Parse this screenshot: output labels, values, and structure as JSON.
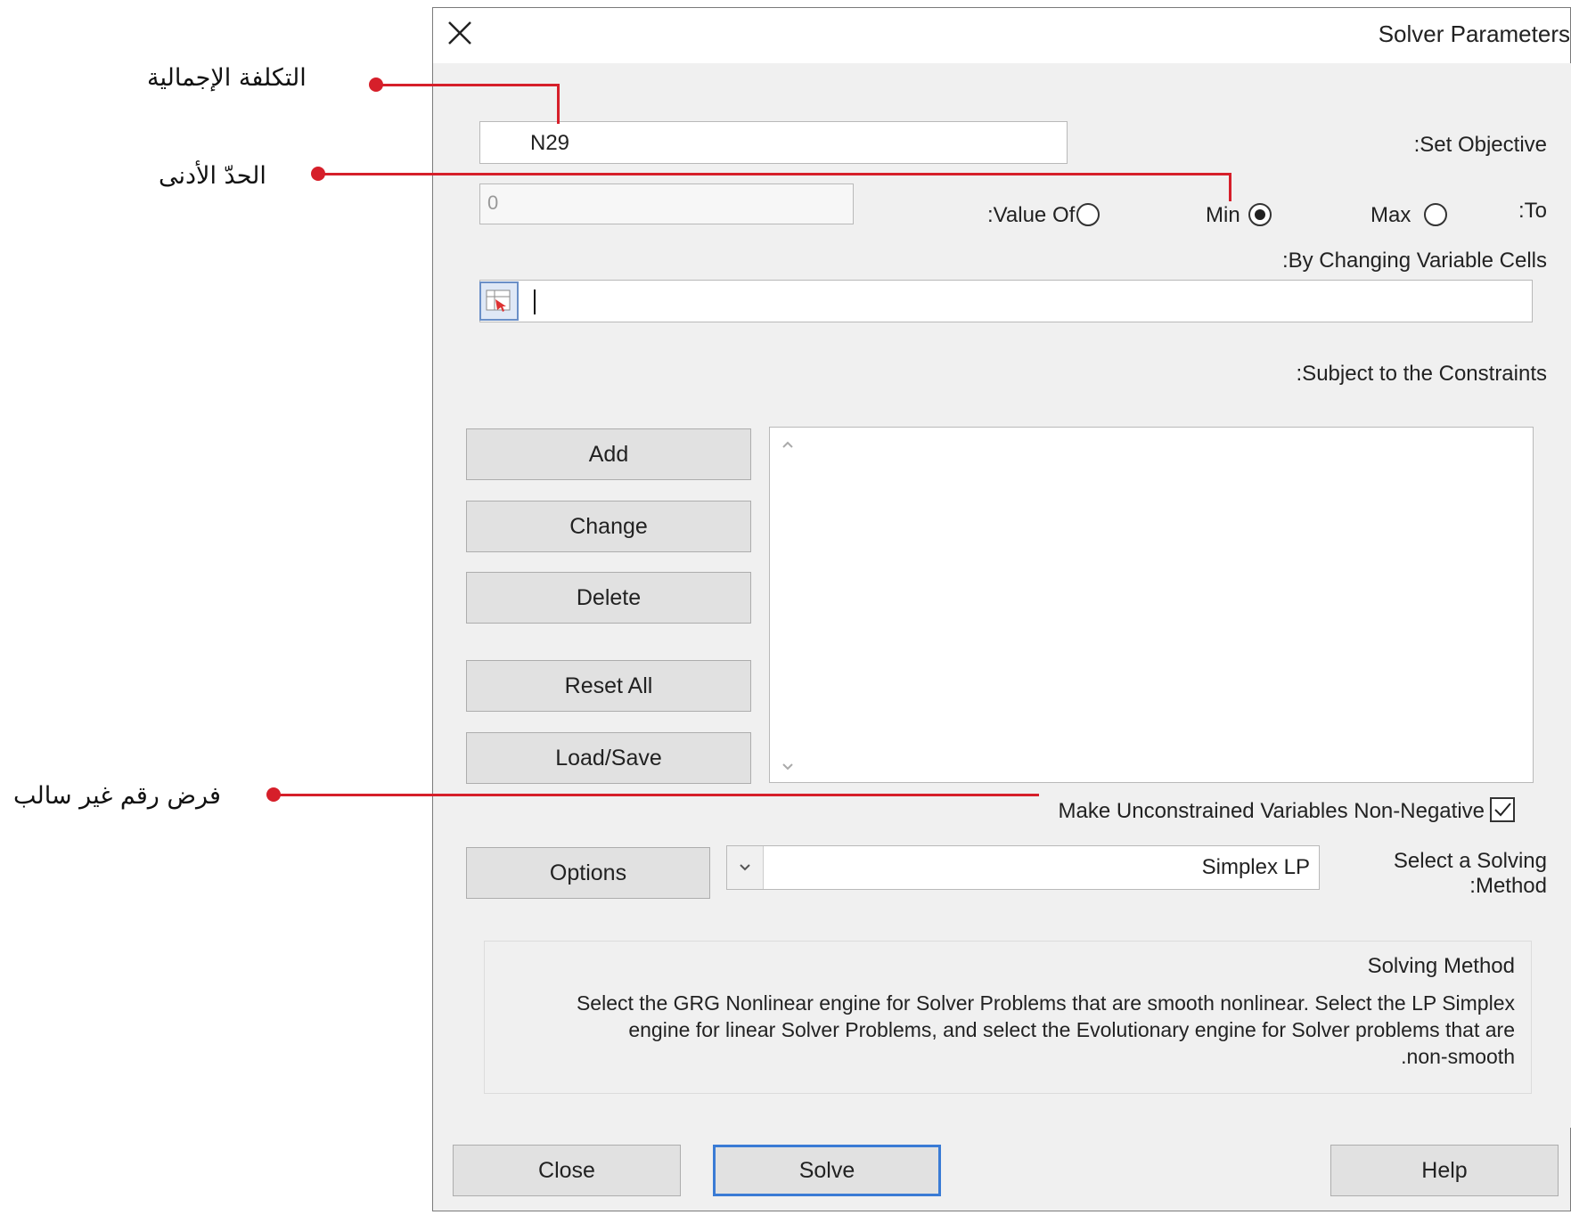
{
  "dialog": {
    "title": "Solver Parameters",
    "set_objective_label": ":Set Objective",
    "objective_value": "N29",
    "to_label": ":To",
    "max_label": "Max",
    "min_label": "Min",
    "value_of_label": ":Value Of",
    "value_of_value": "0",
    "selected_option": "Min",
    "changing_cells_label": ":By Changing Variable Cells",
    "changing_cells_value": "",
    "constraints_label": ":Subject to the Constraints",
    "buttons": {
      "add": "Add",
      "change": "Change",
      "delete": "Delete",
      "reset_all": "Reset All",
      "load_save": "Load/Save",
      "options": "Options",
      "close": "Close",
      "solve": "Solve",
      "help": "Help"
    },
    "non_negative_label": "Make Unconstrained Variables Non-Negative",
    "non_negative_checked": true,
    "solving_method_label_1": "Select a Solving",
    "solving_method_label_2": ":Method",
    "solving_method_value": "Simplex LP",
    "group_title": "Solving Method",
    "description_lines": [
      "Select the GRG Nonlinear engine for Solver Problems that are smooth nonlinear. Select the LP Simplex",
      "engine for linear Solver Problems, and select the Evolutionary engine for Solver problems that are",
      ".non-smooth"
    ]
  },
  "annotations": {
    "total_cost": "التكلفة الإجمالية",
    "minimum": "الحدّ الأدنى",
    "non_negative": "فرض رقم غير سالب"
  },
  "colors": {
    "annotation_red": "#d61f2a",
    "default_button_border": "#3a7bd5"
  }
}
